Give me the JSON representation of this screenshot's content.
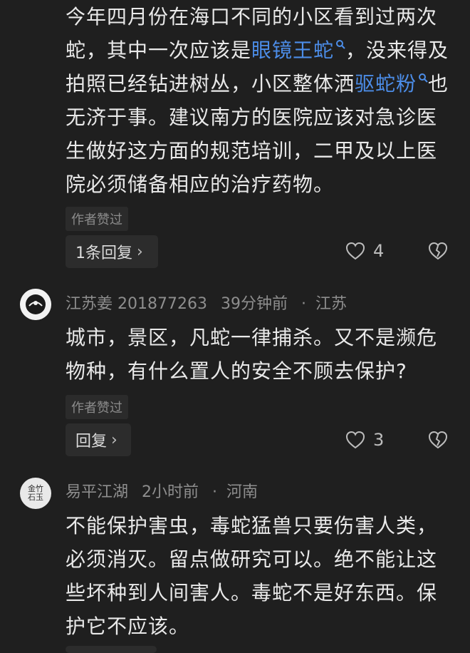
{
  "comment1": {
    "text_parts": [
      "今年四月份在海口不同的小区看到过两次蛇，其中一次应该是",
      "眼镜王蛇",
      "，没来得及拍照已经钻进树丛，小区整体洒",
      "驱蛇粉",
      "也无济于事。建议南方的医院应该对急诊医生做好这方面的规范培训，二甲及以上医院必须储备相应的治疗药物。"
    ],
    "badge": "作者赞过",
    "reply_label": "1条回复",
    "likes": "4"
  },
  "comment2": {
    "username": "江苏姜 201877263",
    "time": "39分钟前",
    "location": "江苏",
    "text": "城市，景区，凡蛇一律捕杀。又不是濒危物种，有什么置人的安全不顾去保护?",
    "badge": "作者赞过",
    "reply_label": "回复",
    "likes": "3"
  },
  "comment3": {
    "username": "易平江湖",
    "time": "2小时前",
    "location": "河南",
    "text": "不能保护害虫，毒蛇猛兽只要伤害人类，必须消灭。留点做研究可以。绝不能让这些坏种到人间害人。毒蛇不是好东西。保护它不应该。",
    "avatar_text": "金竹石玉"
  },
  "colors": {
    "background": "#1f1f1f",
    "link": "#4c8de8",
    "muted": "#8e8e8e"
  }
}
